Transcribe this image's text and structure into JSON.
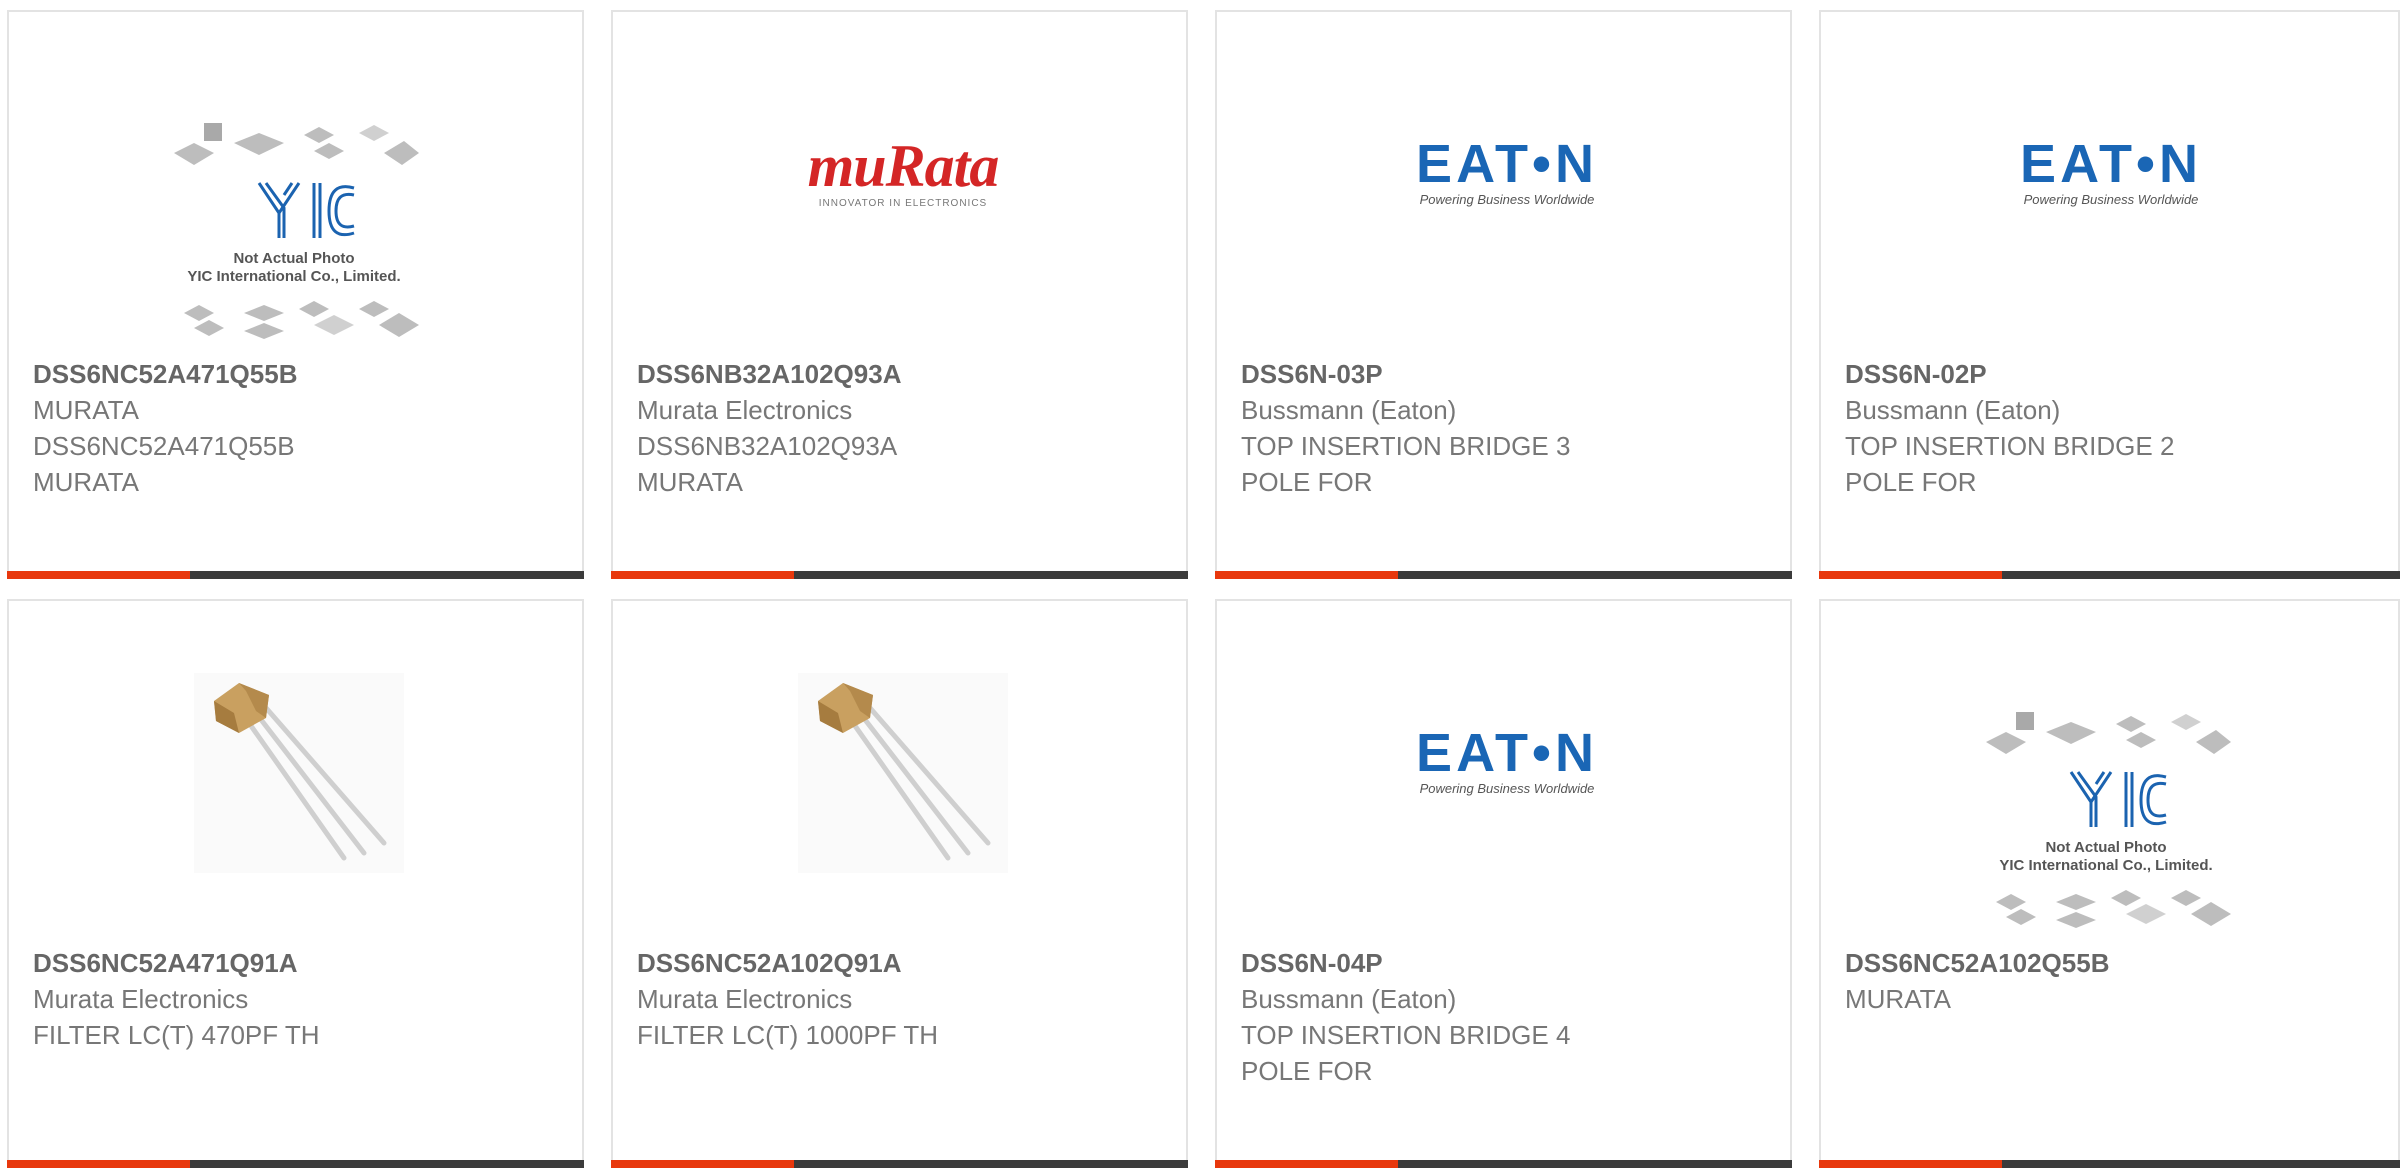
{
  "products": [
    {
      "part": "DSS6NC52A471Q55B",
      "manufacturer": "MURATA",
      "description": "DSS6NC52A471Q55B MURATA",
      "image": "yic-placeholder"
    },
    {
      "part": "DSS6NB32A102Q93A",
      "manufacturer": "Murata Electronics",
      "description": "DSS6NB32A102Q93A MURATA",
      "image": "murata-logo"
    },
    {
      "part": "DSS6N-03P",
      "manufacturer": "Bussmann (Eaton)",
      "description": "TOP INSERTION BRIDGE 3 POLE FOR",
      "image": "eaton-logo"
    },
    {
      "part": "DSS6N-02P",
      "manufacturer": "Bussmann (Eaton)",
      "description": "TOP INSERTION BRIDGE 2 POLE FOR",
      "image": "eaton-logo"
    },
    {
      "part": "DSS6NC52A471Q91A",
      "manufacturer": "Murata Electronics",
      "description": "FILTER LC(T) 470PF TH",
      "image": "capacitor-photo"
    },
    {
      "part": "DSS6NC52A102Q91A",
      "manufacturer": "Murata Electronics",
      "description": "FILTER LC(T) 1000PF TH",
      "image": "capacitor-photo"
    },
    {
      "part": "DSS6N-04P",
      "manufacturer": "Bussmann (Eaton)",
      "description": "TOP INSERTION BRIDGE 4 POLE FOR",
      "image": "eaton-logo"
    },
    {
      "part": "DSS6NC52A102Q55B",
      "manufacturer": "MURATA",
      "description": "",
      "image": "yic-placeholder"
    }
  ],
  "logos": {
    "murata": {
      "word": "muRata",
      "tagline": "INNOVATOR IN ELECTRONICS"
    },
    "eaton": {
      "word": "EAT•N",
      "tagline": "Powering Business Worldwide"
    },
    "yic": {
      "mark": "YIC",
      "caption1": "Not Actual Photo",
      "caption2": "YIC International Co., Limited."
    }
  },
  "colors": {
    "accent": "#e8380d",
    "bar": "#3b3b3b",
    "border": "#e3e3e3",
    "murata_red": "#d42626",
    "eaton_blue": "#1a66b5"
  }
}
